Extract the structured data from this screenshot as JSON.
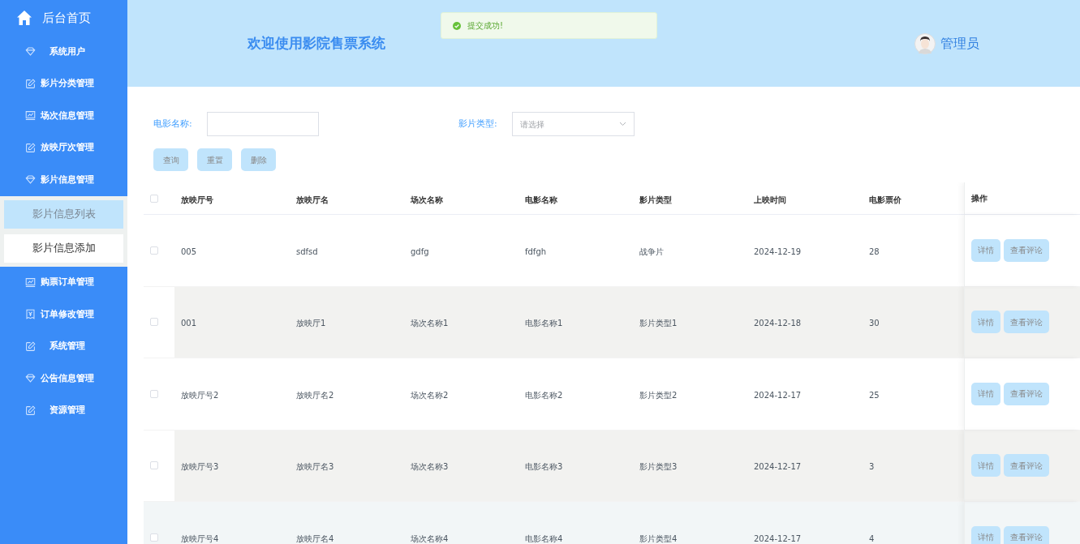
{
  "sidebar": {
    "home": {
      "label": "后台首页"
    },
    "items": [
      {
        "label": "系统用户",
        "kind": "diamond"
      },
      {
        "label": "影片分类管理",
        "kind": "edit"
      },
      {
        "label": "场次信息管理",
        "kind": "chart"
      },
      {
        "label": "放映厅次管理",
        "kind": "edit"
      },
      {
        "label": "影片信息管理",
        "kind": "diamond",
        "expanded": true,
        "children": [
          {
            "label": "影片信息列表",
            "selected": true
          },
          {
            "label": "影片信息添加",
            "selected": false
          }
        ]
      },
      {
        "label": "购票订单管理",
        "kind": "chart"
      },
      {
        "label": "订单修改管理",
        "kind": "receipt"
      },
      {
        "label": "系统管理",
        "kind": "edit"
      },
      {
        "label": "公告信息管理",
        "kind": "diamond"
      },
      {
        "label": "资源管理",
        "kind": "edit"
      }
    ]
  },
  "header": {
    "title": "欢迎使用影院售票系统",
    "user": "管理员"
  },
  "toast": {
    "message": "提交成功!"
  },
  "filters": [
    {
      "label": "电影名称:",
      "kind": "text"
    },
    {
      "label": "影片类型:",
      "kind": "select",
      "placeholder": "请选择"
    }
  ],
  "buttons": [
    "查询",
    "重置",
    "删除"
  ],
  "table": {
    "all_checked": false,
    "columns": [
      "放映厅号",
      "放映厅名",
      "场次名称",
      "电影名称",
      "影片类型",
      "上映时间",
      "电影票价",
      "操作"
    ],
    "rows": [
      {
        "cells": [
          "005",
          "sdfsd",
          "gdfg",
          "fdfgh",
          "战争片",
          "2024-12-19",
          "28"
        ],
        "checked": false,
        "hovered": false,
        "actions": [
          "详情",
          "查看评论"
        ]
      },
      {
        "cells": [
          "001",
          "放映厅1",
          "场次名称1",
          "电影名称1",
          "影片类型1",
          "2024-12-18",
          "30"
        ],
        "checked": false,
        "hovered": false,
        "actions": [
          "详情",
          "查看评论"
        ]
      },
      {
        "cells": [
          "放映厅号2",
          "放映厅名2",
          "场次名称2",
          "电影名称2",
          "影片类型2",
          "2024-12-17",
          "25"
        ],
        "checked": false,
        "hovered": false,
        "actions": [
          "详情",
          "查看评论"
        ]
      },
      {
        "cells": [
          "放映厅号3",
          "放映厅名3",
          "场次名称3",
          "电影名称3",
          "影片类型3",
          "2024-12-17",
          "3"
        ],
        "checked": false,
        "hovered": false,
        "actions": [
          "详情",
          "查看评论"
        ]
      },
      {
        "cells": [
          "放映厅号4",
          "放映厅名4",
          "场次名称4",
          "电影名称4",
          "影片类型4",
          "2024-12-17",
          "4"
        ],
        "checked": false,
        "hovered": true,
        "actions": [
          "详情",
          "查看评论"
        ]
      }
    ]
  }
}
